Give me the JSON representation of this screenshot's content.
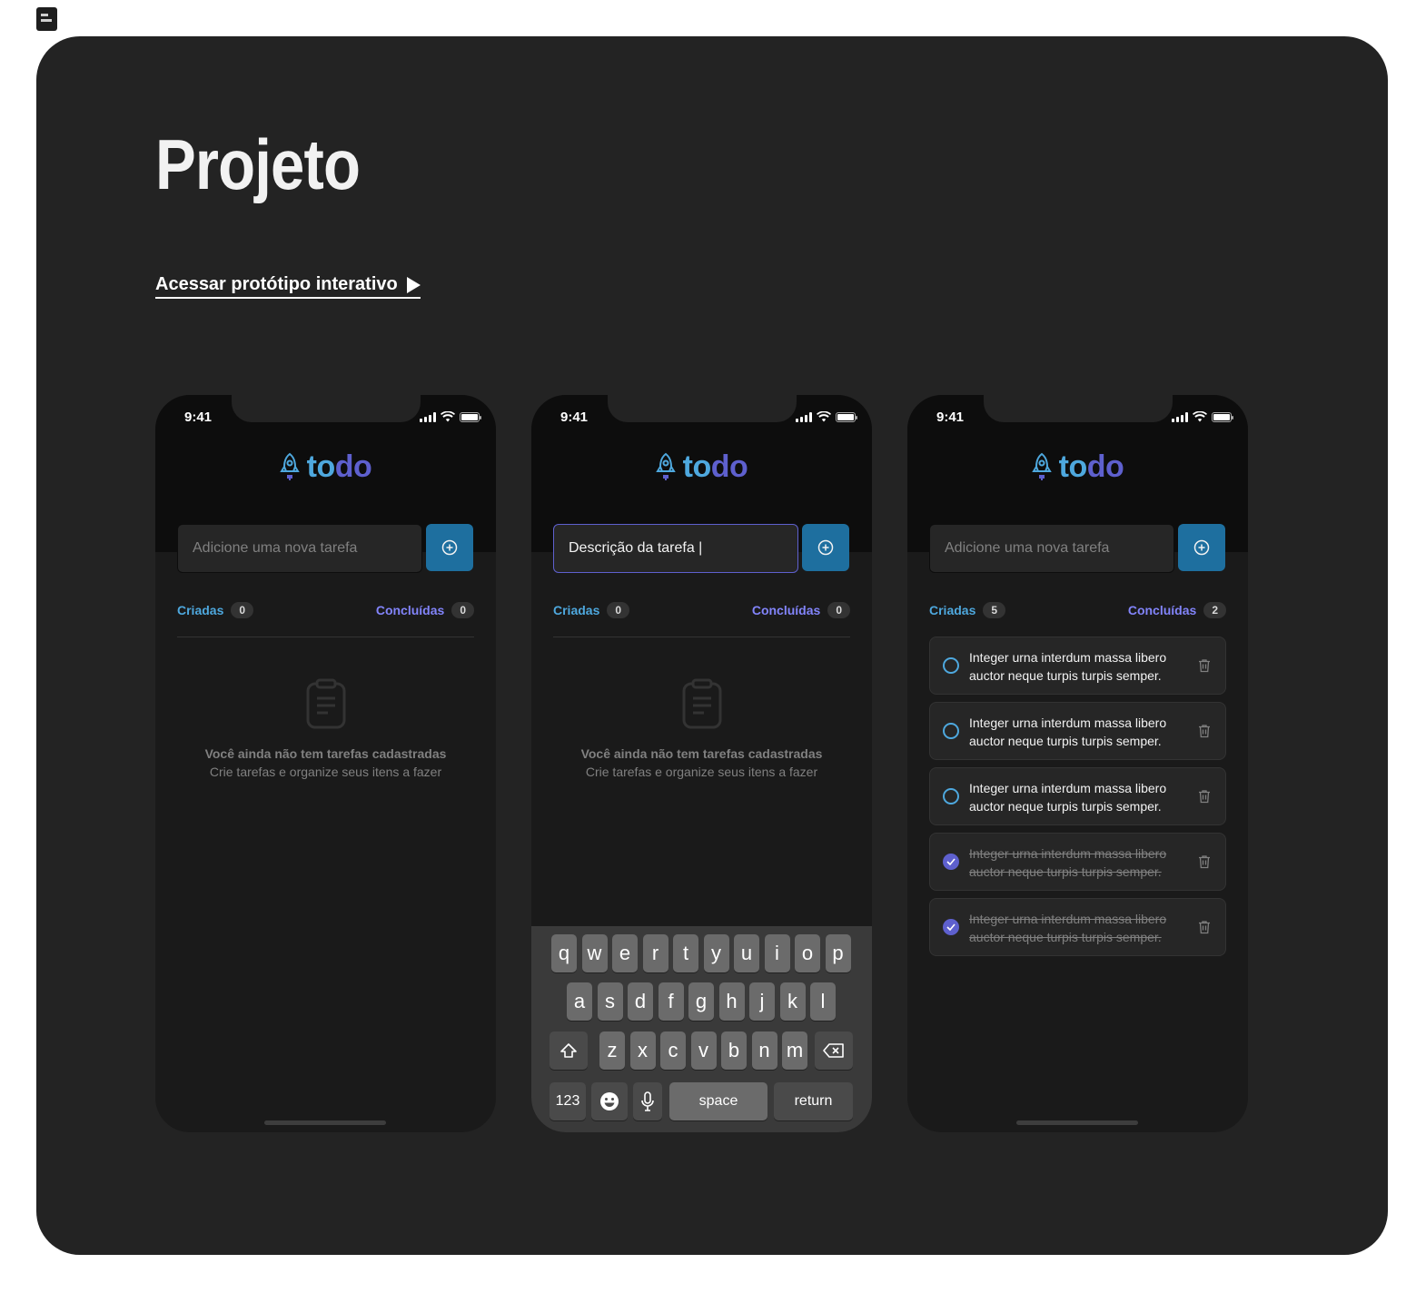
{
  "page": {
    "title": "Projeto",
    "prototype_link": "Acessar protótipo interativo"
  },
  "app": {
    "time": "9:41",
    "logo_to": "to",
    "logo_do": "do",
    "placeholder": "Adicione uma nova tarefa",
    "typed_value": "Descrição da tarefa |",
    "created_label": "Criadas",
    "done_label": "Concluídas"
  },
  "screen1": {
    "created_count": "0",
    "done_count": "0"
  },
  "screen2": {
    "created_count": "0",
    "done_count": "0"
  },
  "screen3": {
    "created_count": "5",
    "done_count": "2",
    "tasks": [
      {
        "text": "Integer urna interdum massa libero auctor neque turpis turpis semper.",
        "done": false
      },
      {
        "text": "Integer urna interdum massa libero auctor neque turpis turpis semper.",
        "done": false
      },
      {
        "text": "Integer urna interdum massa libero auctor neque turpis turpis semper.",
        "done": false
      },
      {
        "text": "Integer urna interdum massa libero auctor neque turpis turpis semper.",
        "done": true
      },
      {
        "text": "Integer urna interdum massa libero auctor neque turpis turpis semper.",
        "done": true
      }
    ]
  },
  "empty_state": {
    "title": "Você ainda não tem tarefas cadastradas",
    "subtitle": "Crie tarefas e organize seus itens a fazer"
  },
  "keyboard": {
    "row1": [
      "q",
      "w",
      "e",
      "r",
      "t",
      "y",
      "u",
      "i",
      "o",
      "p"
    ],
    "row2": [
      "a",
      "s",
      "d",
      "f",
      "g",
      "h",
      "j",
      "k",
      "l"
    ],
    "row3": [
      "z",
      "x",
      "c",
      "v",
      "b",
      "n",
      "m"
    ],
    "numbers": "123",
    "space": "space",
    "return": "return"
  },
  "colors": {
    "blue": "#4ea8de",
    "purple": "#5e60ce",
    "purple_light": "#8284fa",
    "blue_dark": "#1e6f9f",
    "background": "#1a1a1a"
  }
}
